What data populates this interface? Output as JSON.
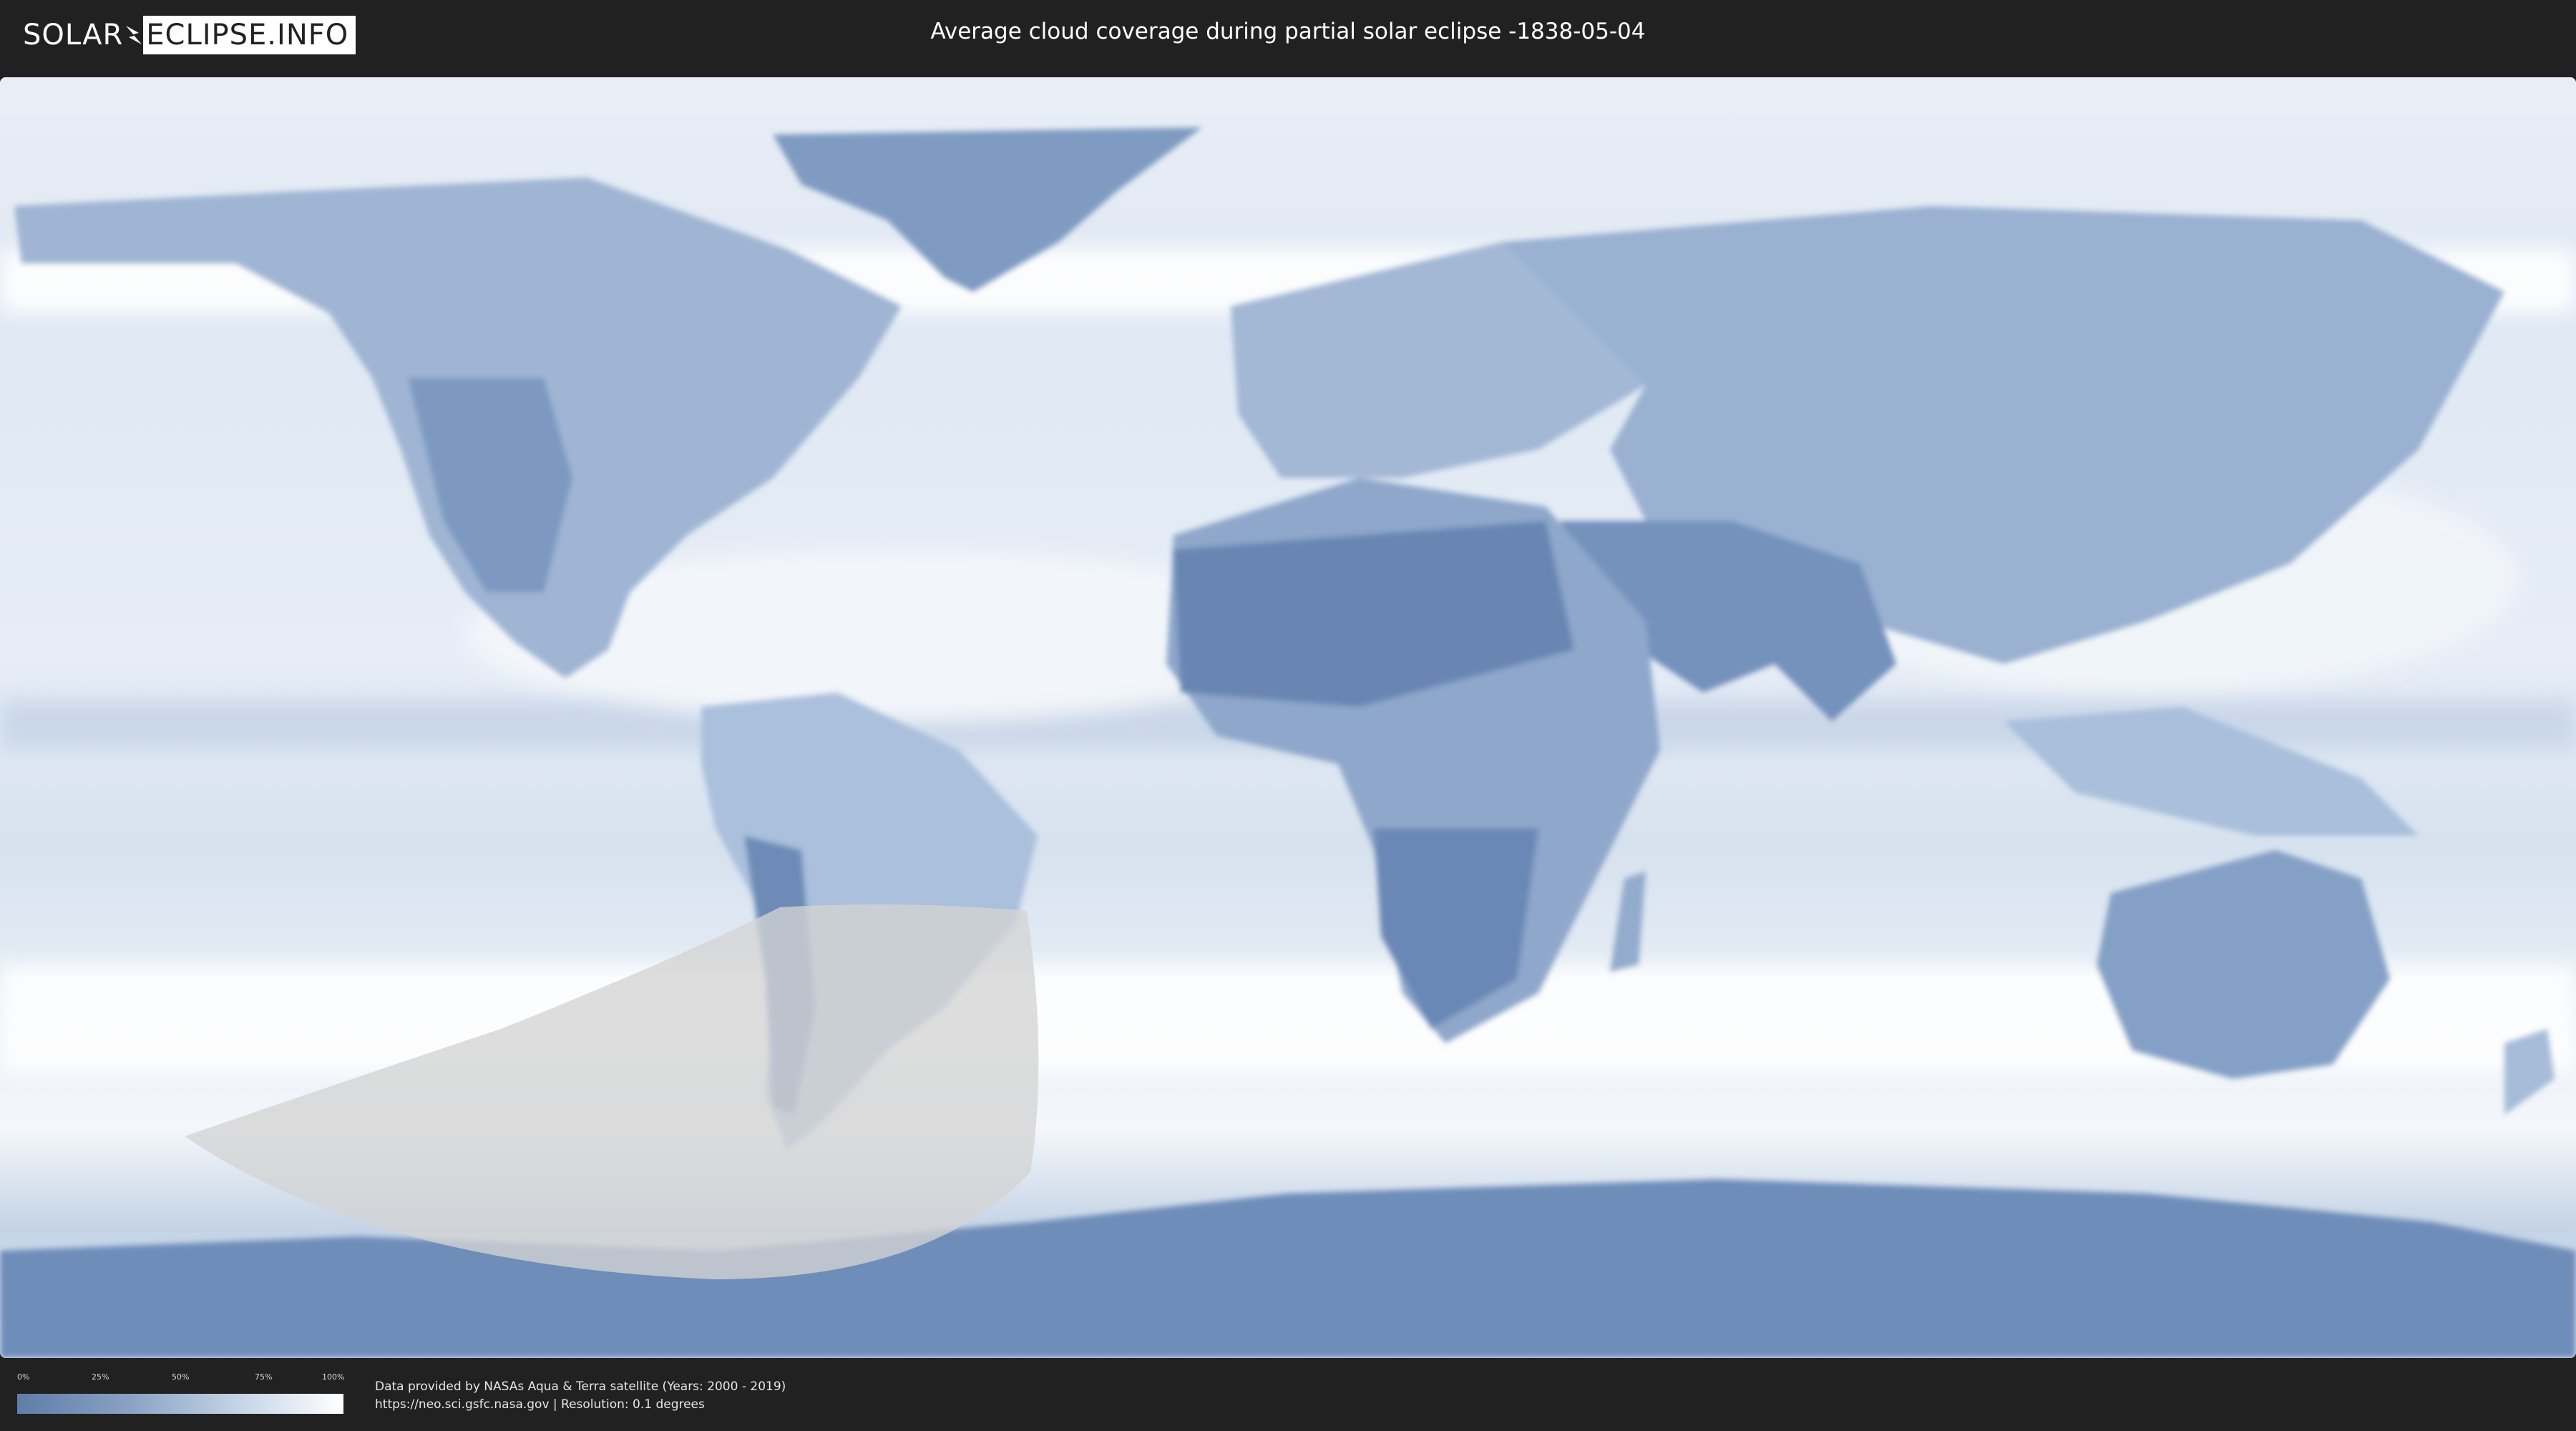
{
  "header": {
    "logo_left": "SOLAR",
    "logo_right": "ECLIPSE.INFO",
    "title": "Average cloud coverage during partial solar eclipse -1838-05-04"
  },
  "legend": {
    "ticks": [
      "0%",
      "25%",
      "50%",
      "75%",
      "100%"
    ],
    "gradient_colors": [
      "#5f7da9",
      "#8aa3c5",
      "#c9d7e8",
      "#ffffff"
    ]
  },
  "credits": {
    "line1": "Data provided by NASAs Aqua & Terra satellite (Years: 2000 - 2019)",
    "line2": "https://neo.sci.gsfc.nasa.gov | Resolution: 0.1 degrees"
  },
  "map": {
    "land_color": "#6f8fb9",
    "cloud_color": "#ffffff",
    "eclipse_zone_color": "#d6d6d6"
  }
}
